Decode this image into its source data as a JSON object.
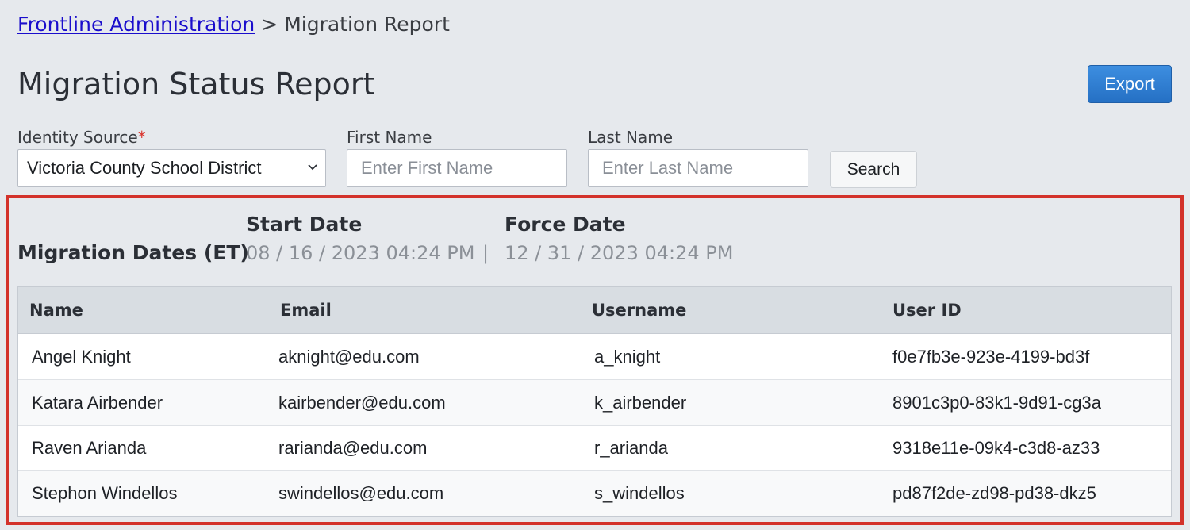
{
  "breadcrumb": {
    "parent_link": "Frontline Administration",
    "separator": ">",
    "current": "Migration Report"
  },
  "page": {
    "title": "Migration Status Report",
    "export_label": "Export"
  },
  "filters": {
    "identity_source": {
      "label": "Identity Source",
      "required_mark": "*",
      "selected": "Victoria County School District"
    },
    "first_name": {
      "label": "First Name",
      "placeholder": "Enter First Name"
    },
    "last_name": {
      "label": "Last Name",
      "placeholder": "Enter Last Name"
    },
    "search_label": "Search"
  },
  "migration_dates": {
    "label": "Migration Dates (ET)",
    "start_heading": "Start Date",
    "start_value": "08 / 16 / 2023 04:24 PM",
    "separator": "|",
    "force_heading": "Force Date",
    "force_value": "12 / 31 / 2023 04:24 PM"
  },
  "table": {
    "columns": [
      "Name",
      "Email",
      "Username",
      "User ID"
    ],
    "rows": [
      [
        "Angel Knight",
        "aknight@edu.com",
        "a_knight",
        "f0e7fb3e-923e-4199-bd3f"
      ],
      [
        "Katara Airbender",
        "kairbender@edu.com",
        "k_airbender",
        "8901c3p0-83k1-9d91-cg3a"
      ],
      [
        "Raven Arianda",
        "rarianda@edu.com",
        "r_arianda",
        "9318e11e-09k4-c3d8-az33"
      ],
      [
        "Stephon Windellos",
        "swindellos@edu.com",
        "s_windellos",
        "pd87f2de-zd98-pd38-dkz5"
      ]
    ]
  },
  "colors": {
    "accent": "#2a7bd0",
    "highlight_border": "#d3322b",
    "link": "#1a0dcc",
    "background": "#e6e9ed"
  }
}
